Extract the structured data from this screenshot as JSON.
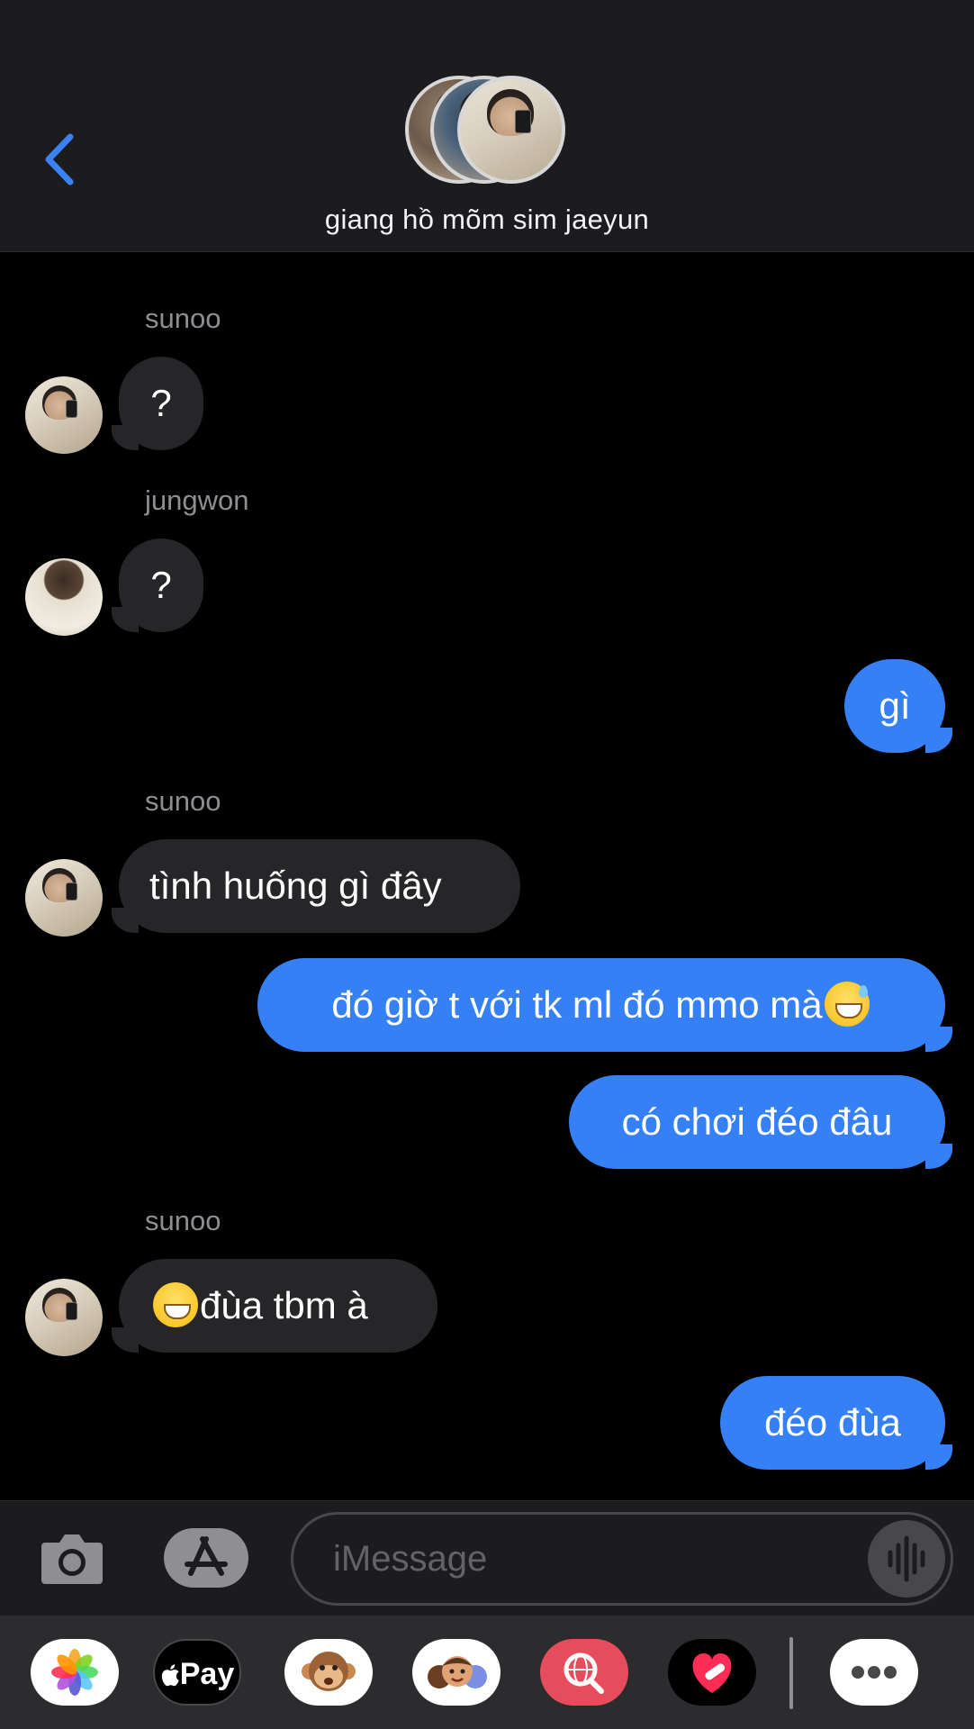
{
  "header": {
    "group_name": "giang hồ mõm sim jaeyun"
  },
  "messages": [
    {
      "sender": "sunoo",
      "text": "?"
    },
    {
      "sender": "jungwon",
      "text": "?"
    },
    {
      "from_me": true,
      "text": "gì"
    },
    {
      "sender": "sunoo",
      "text": "tình huống gì đây"
    },
    {
      "from_me": true,
      "text": "đó giờ t với tk ml đó mmo mà"
    },
    {
      "from_me": true,
      "text": "có chơi đéo đâu"
    },
    {
      "sender": "sunoo",
      "text": "đùa tbm à"
    },
    {
      "from_me": true,
      "text": "đéo đùa"
    }
  ],
  "input": {
    "placeholder": "iMessage"
  },
  "drawer": {
    "apple_pay_label": "Pay"
  },
  "icons": [
    "back-chevron-icon",
    "camera-icon",
    "app-store-icon",
    "audio-waveform-icon",
    "photos-icon",
    "apple-pay-icon",
    "animoji-monkey-icon",
    "memoji-icon",
    "image-search-icon",
    "digital-touch-heart-icon",
    "more-apps-icon"
  ],
  "colors": {
    "accent": "#3580f5",
    "incoming_bubble": "#262628",
    "background": "#000000",
    "bar_background": "#1c1c1e"
  }
}
